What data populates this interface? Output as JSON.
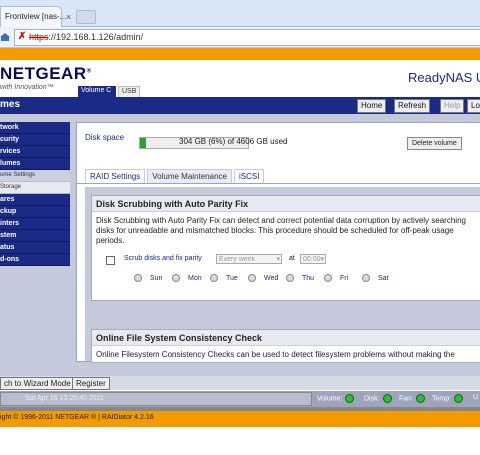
{
  "browser": {
    "tab_title": "Frontview [nas-...",
    "tab_close": "×",
    "url_scheme": "https",
    "url_rest": "://192.168.1.126/admin/"
  },
  "header": {
    "logo": "NETGEAR",
    "logo_reg": "®",
    "tagline": "with Innovation™",
    "volume_tab": "Volume C",
    "usb_tab": "USB",
    "product": "ReadyNAS UI"
  },
  "titlebar": {
    "section": "mes",
    "home": "Home",
    "refresh": "Refresh",
    "help": "Help",
    "logout": "Lo"
  },
  "sidebar": {
    "items": [
      {
        "label": "twork",
        "type": "head"
      },
      {
        "label": "curity",
        "type": "head"
      },
      {
        "label": "rvices",
        "type": "head"
      },
      {
        "label": "lumes",
        "type": "head"
      },
      {
        "label": "ume Settings",
        "type": "sub",
        "selected": true
      },
      {
        "label": "Storage",
        "type": "sub"
      },
      {
        "label": "ares",
        "type": "head"
      },
      {
        "label": "ckup",
        "type": "head"
      },
      {
        "label": "inters",
        "type": "head"
      },
      {
        "label": "stem",
        "type": "head"
      },
      {
        "label": "atus",
        "type": "head"
      },
      {
        "label": "d-ons",
        "type": "head"
      }
    ]
  },
  "disk": {
    "label": "Disk space",
    "usage_fraction": 0.06,
    "usage_text": "304 GB (6%) of 4606 GB used",
    "delete_btn": "Delete volume"
  },
  "tabs": [
    "RAID Settings",
    "Volume Maintenance",
    "iSCSI"
  ],
  "scrub": {
    "title": "Disk Scrubbing with Auto Parity Fix",
    "description": "Disk Scrubbing with Auto Parity Fix can detect and correct potential data corruption by actively searching disks for unreadable and mismatched blocks. This procedure should be scheduled for off-peak usage periods.",
    "checkbox_label": "Scrub disks and fix parity",
    "frequency": "Every week",
    "at_label": "at",
    "time": "00:00",
    "days": [
      "Sun",
      "Mon",
      "Tue",
      "Wed",
      "Thu",
      "Fri",
      "Sat"
    ]
  },
  "fscheck": {
    "title": "Online File System Consistency Check",
    "description": "Online Filesystem Consistency Checks can be used to detect filesystem problems without making the"
  },
  "bottom": {
    "wizard_btn": "ch to Wizard Mode",
    "register_btn": "Register"
  },
  "status": {
    "datetime": "Sat Apr 16  13:20:40 2011",
    "volume": "Volume:",
    "disk": "Disk:",
    "fan": "Fan:",
    "temp": "Temp:",
    "ups": "U",
    "led_color": "#2bbf2b"
  },
  "footer": {
    "text": "ight © 1996-2011 NETGEAR ® | RAIDiator 4.2.16"
  }
}
